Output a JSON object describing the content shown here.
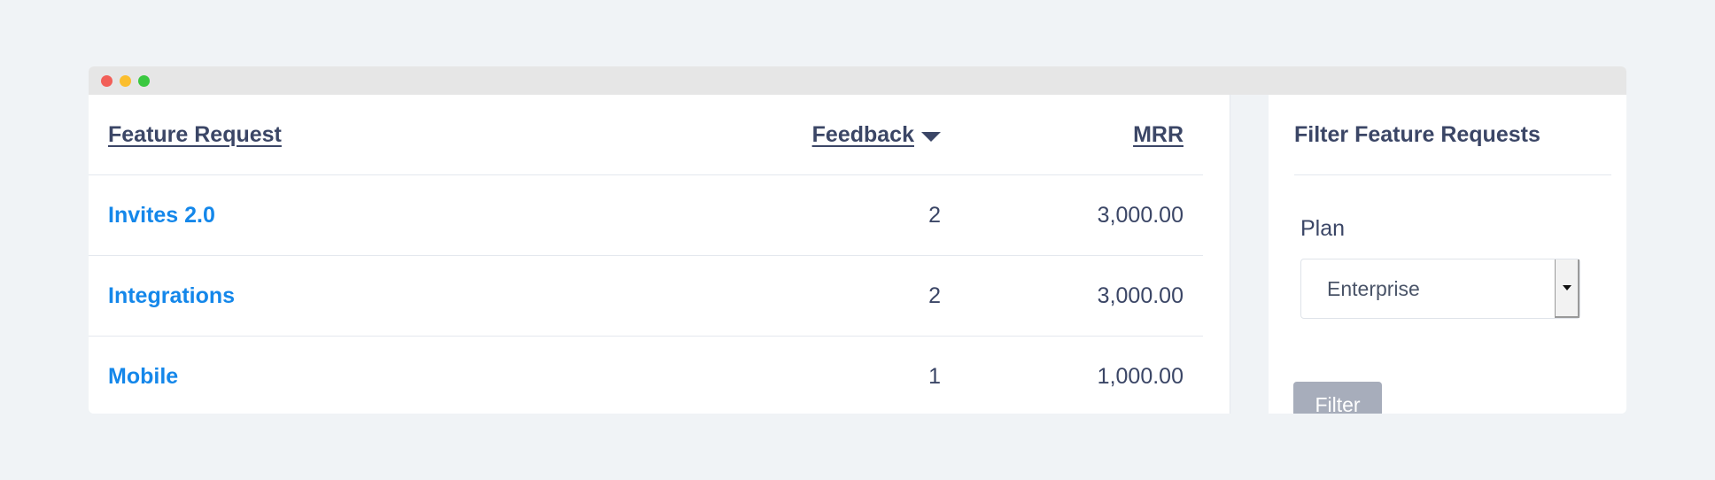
{
  "window": {
    "controls": [
      "close",
      "minimize",
      "maximize"
    ],
    "colors": {
      "close": "#f25f58",
      "minimize": "#fbbe2e",
      "maximize": "#3ac840"
    }
  },
  "table": {
    "headers": {
      "feature_request": "Feature Request",
      "feedback": "Feedback",
      "mrr": "MRR"
    },
    "sort": {
      "column": "Feedback",
      "direction": "descending",
      "icon": "sort-desc-icon"
    },
    "rows": [
      {
        "name": "Invites 2.0",
        "feedback": "2",
        "mrr": "3,000.00"
      },
      {
        "name": "Integrations",
        "feedback": "2",
        "mrr": "3,000.00"
      },
      {
        "name": "Mobile",
        "feedback": "1",
        "mrr": "1,000.00"
      }
    ],
    "link_color": "#1487ea"
  },
  "filter": {
    "title": "Filter Feature Requests",
    "plan_label": "Plan",
    "plan_selected": "Enterprise",
    "button_label": "Filter",
    "button_color": "#a7adbb"
  }
}
